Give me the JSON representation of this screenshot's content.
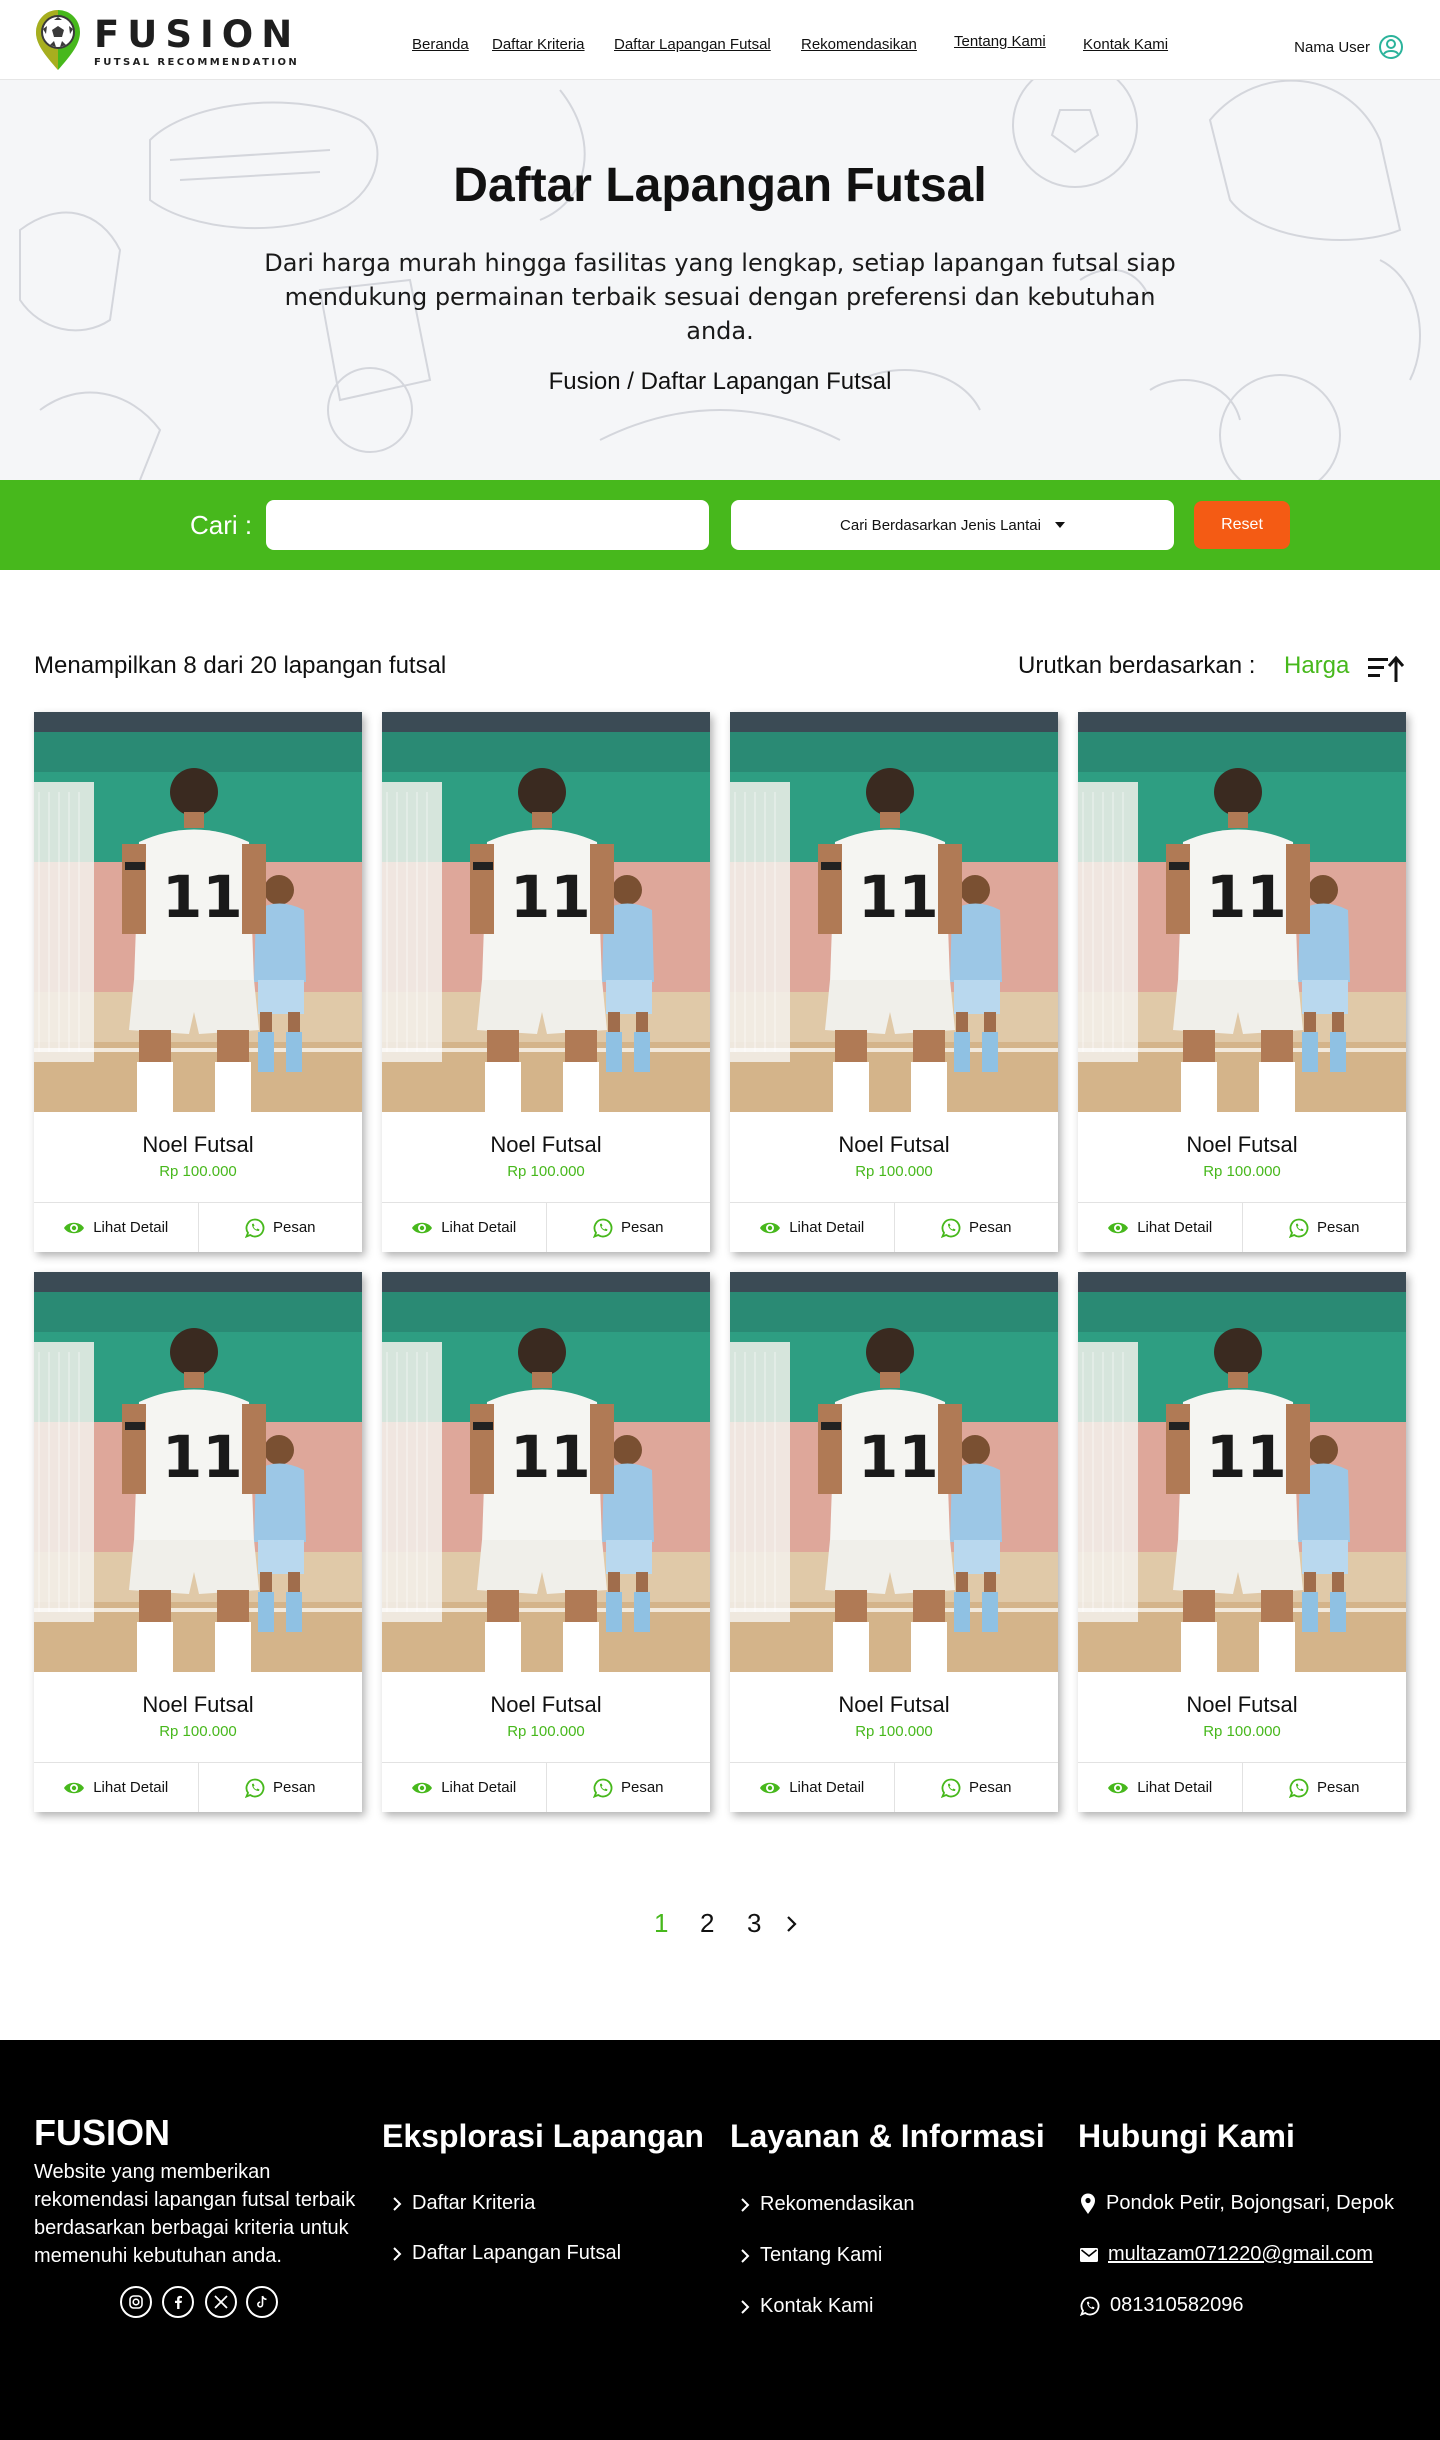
{
  "brand": {
    "name": "FUSION",
    "tagline": "FUTSAL RECOMMENDATION",
    "accent_color": "#47b81c",
    "logo_dark_color": "#3a3a3a"
  },
  "nav": {
    "items": [
      {
        "label": "Beranda"
      },
      {
        "label": "Daftar Kriteria"
      },
      {
        "label": "Daftar Lapangan Futsal"
      },
      {
        "label": "Rekomendasikan"
      },
      {
        "label": "Tentang Kami"
      },
      {
        "label": "Kontak Kami"
      }
    ],
    "user_label": "Nama User",
    "user_icon": "user-circle-icon"
  },
  "hero": {
    "title": "Daftar Lapangan Futsal",
    "description": "Dari harga murah hingga fasilitas yang lengkap, setiap lapangan futsal siap mendukung permainan terbaik sesuai dengan preferensi dan kebutuhan anda.",
    "breadcrumb": "Fusion / Daftar Lapangan Futsal"
  },
  "search": {
    "label": "Cari :",
    "value": "",
    "placeholder": "",
    "floor_filter_label": "Cari Berdasarkan Jenis Lantai",
    "reset_label": "Reset",
    "bar_color": "#47b81c",
    "reset_color": "#f45b14"
  },
  "results": {
    "summary": "Menampilkan 8 dari 20 lapangan futsal",
    "sort_label": "Urutkan berdasarkan :",
    "sort_value": "Harga",
    "sort_icon": "sort-ascending-icon"
  },
  "cards": [
    {
      "name": "Noel Futsal",
      "price": "Rp 100.000",
      "detail_label": "Lihat Detail",
      "order_label": "Pesan"
    },
    {
      "name": "Noel Futsal",
      "price": "Rp 100.000",
      "detail_label": "Lihat Detail",
      "order_label": "Pesan"
    },
    {
      "name": "Noel Futsal",
      "price": "Rp 100.000",
      "detail_label": "Lihat Detail",
      "order_label": "Pesan"
    },
    {
      "name": "Noel Futsal",
      "price": "Rp 100.000",
      "detail_label": "Lihat Detail",
      "order_label": "Pesan"
    },
    {
      "name": "Noel Futsal",
      "price": "Rp 100.000",
      "detail_label": "Lihat Detail",
      "order_label": "Pesan"
    },
    {
      "name": "Noel Futsal",
      "price": "Rp 100.000",
      "detail_label": "Lihat Detail",
      "order_label": "Pesan"
    },
    {
      "name": "Noel Futsal",
      "price": "Rp 100.000",
      "detail_label": "Lihat Detail",
      "order_label": "Pesan"
    },
    {
      "name": "Noel Futsal",
      "price": "Rp 100.000",
      "detail_label": "Lihat Detail",
      "order_label": "Pesan"
    }
  ],
  "pagination": {
    "pages": [
      "1",
      "2",
      "3"
    ],
    "current": "1"
  },
  "footer": {
    "brand": "FUSION",
    "description": "Website yang memberikan rekomendasi lapangan futsal terbaik berdasarkan berbagai kriteria untuk memenuhi kebutuhan anda.",
    "socials": [
      "instagram-icon",
      "facebook-icon",
      "x-icon",
      "tiktok-icon"
    ],
    "explore": {
      "heading": "Eksplorasi Lapangan",
      "links": [
        "Daftar Kriteria",
        "Daftar Lapangan Futsal"
      ]
    },
    "services": {
      "heading": "Layanan & Informasi",
      "links": [
        "Rekomendasikan",
        "Tentang Kami",
        "Kontak Kami"
      ]
    },
    "contact": {
      "heading": "Hubungi Kami",
      "address": "Pondok Petir,  Bojongsari, Depok",
      "email": "multazam071220@gmail.com",
      "phone": "081310582096"
    }
  }
}
